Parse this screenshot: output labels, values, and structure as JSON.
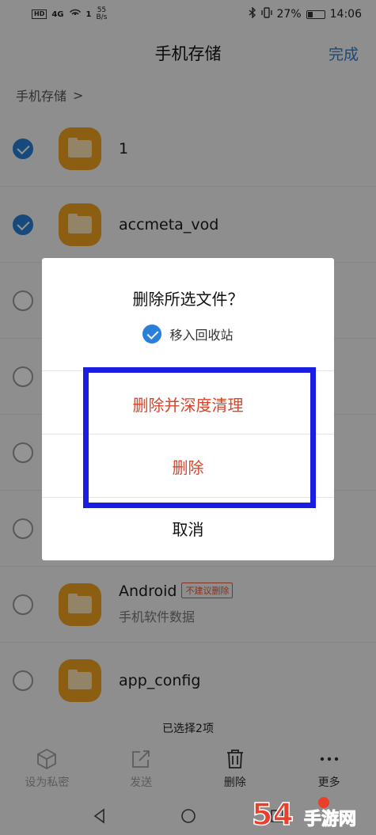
{
  "status_bar": {
    "hd": "HD",
    "signal": "4G",
    "hotspot_count": "1",
    "speed_value": "55",
    "speed_unit": "B/s",
    "battery_text": "27%",
    "time": "14:06"
  },
  "header": {
    "title": "手机存储",
    "done_label": "完成"
  },
  "breadcrumb": {
    "label": "手机存储",
    "separator": ">"
  },
  "files": [
    {
      "name": "1",
      "checked": true
    },
    {
      "name": "accmeta_vod",
      "checked": true
    },
    {
      "name": "",
      "checked": false
    },
    {
      "name": "",
      "checked": false
    },
    {
      "name": "",
      "checked": false
    },
    {
      "name": "",
      "checked": false
    },
    {
      "name": "Android",
      "tag": "不建议删除",
      "subtitle": "手机软件数据",
      "checked": false
    },
    {
      "name": "app_config",
      "checked": false
    }
  ],
  "selection": {
    "count_text": "已选择2项"
  },
  "toolbar": {
    "private_label": "设为私密",
    "send_label": "发送",
    "delete_label": "删除",
    "more_label": "更多"
  },
  "dialog": {
    "title": "删除所选文件？",
    "recycle_label": "移入回收站",
    "recycle_checked": true,
    "deep_clean_label": "删除并深度清理",
    "delete_label": "删除",
    "cancel_label": "取消"
  },
  "watermark": {
    "text": "54 手游网",
    "url": "5466.com"
  },
  "colors": {
    "accent": "#2a7fd8",
    "danger": "#d8452b",
    "folder": "#f2a31f",
    "highlight": "#1a1ee0"
  }
}
